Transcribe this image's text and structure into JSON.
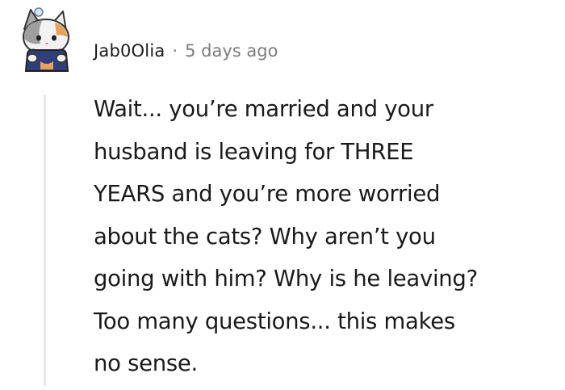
{
  "comment": {
    "author": "Jab0Olia",
    "separator": "·",
    "timestamp": "5 days ago",
    "avatar_icon": "cat-avatar-icon",
    "body_lines": [
      "Wait... you’re married and your",
      "husband is leaving for THREE",
      "YEARS and you’re more worried",
      "about the cats? Why aren’t you",
      "going with him? Why is he leaving?",
      "Too many questions... this makes",
      "no sense."
    ]
  },
  "colors": {
    "text": "#1a1a1b",
    "meta": "#7c7c7c",
    "thread_line": "#e5e7e8"
  }
}
